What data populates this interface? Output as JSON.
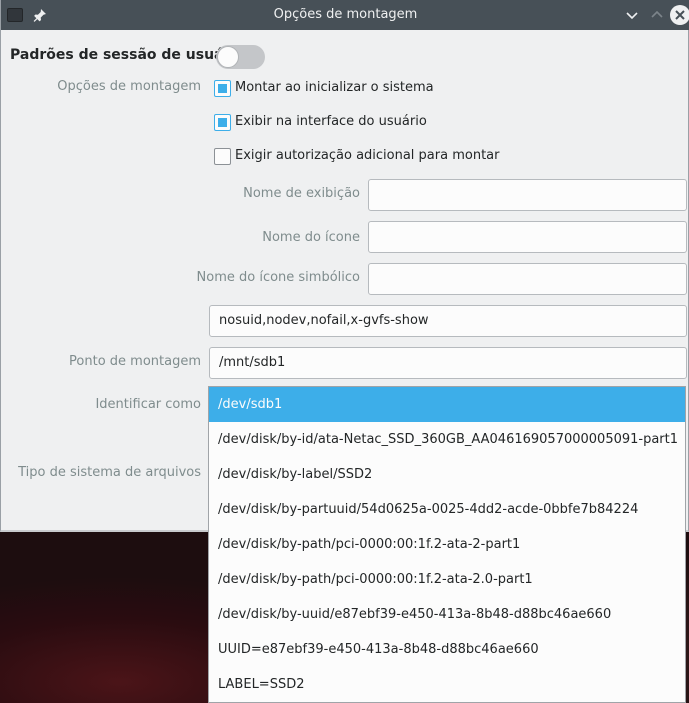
{
  "window": {
    "title": "Opções de montagem"
  },
  "session": {
    "label": "Padrões de sessão de usuário",
    "enabled": false
  },
  "mount_options": {
    "section_label": "Opções de montagem",
    "checkboxes": [
      {
        "label": "Montar ao inicializar o sistema",
        "checked": true
      },
      {
        "label": "Exibir na interface do usuário",
        "checked": true
      },
      {
        "label": "Exigir autorização adicional para montar",
        "checked": false
      }
    ],
    "display_name_label": "Nome de exibição",
    "display_name_value": "",
    "icon_name_label": "Nome do ícone",
    "icon_name_value": "",
    "symbolic_icon_label": "Nome do ícone simbólico",
    "symbolic_icon_value": "",
    "options_value": "nosuid,nodev,nofail,x-gvfs-show",
    "mount_point_label": "Ponto de montagem",
    "mount_point_value": "/mnt/sdb1",
    "identify_as_label": "Identificar como",
    "fs_type_label": "Tipo de sistema de arquivos"
  },
  "identify_dropdown": {
    "items": [
      "/dev/sdb1",
      "/dev/disk/by-id/ata-Netac_SSD_360GB_AA046169057000005091-part1",
      "/dev/disk/by-label/SSD2",
      "/dev/disk/by-partuuid/54d0625a-0025-4dd2-acde-0bbfe7b84224",
      "/dev/disk/by-path/pci-0000:00:1f.2-ata-2-part1",
      "/dev/disk/by-path/pci-0000:00:1f.2-ata-2.0-part1",
      "/dev/disk/by-uuid/e87ebf39-e450-413a-8b48-d88bc46ae660",
      "UUID=e87ebf39-e450-413a-8b48-d88bc46ae660",
      "LABEL=SSD2"
    ],
    "selected_index": 0
  },
  "colors": {
    "accent": "#3daee9",
    "titlebar": "#475057"
  }
}
